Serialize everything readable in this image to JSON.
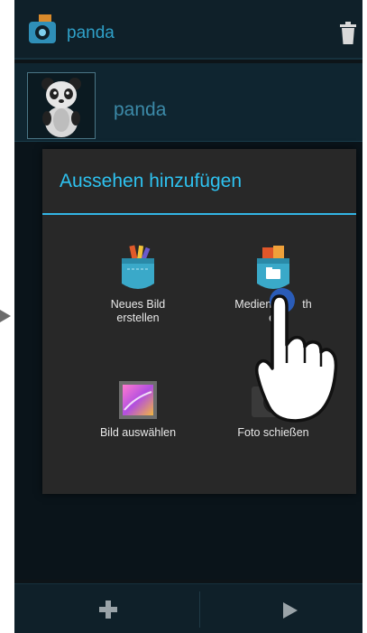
{
  "actionbar": {
    "title": "panda",
    "trash_icon": "trash-icon"
  },
  "look": {
    "name": "panda"
  },
  "dialog": {
    "title": "Aussehen hinzufügen",
    "options": [
      {
        "label_line1": "Neues Bild",
        "label_line2": "erstellen",
        "icon": "paint-pocket-icon"
      },
      {
        "label_line1": "Medien",
        "label_line2": "ei",
        "label_suffix": "th",
        "icon": "media-library-pocket-icon"
      },
      {
        "label_line1": "Bild auswählen",
        "label_line2": "",
        "icon": "gallery-icon"
      },
      {
        "label_line1": "Foto schießen",
        "label_line2": "",
        "icon": "camera-icon"
      }
    ]
  },
  "bottombar": {
    "add_icon": "plus-icon",
    "play_icon": "play-icon"
  },
  "colors": {
    "accent": "#33b5e5",
    "title": "#2ec2f0",
    "dialog_bg": "#282828"
  }
}
